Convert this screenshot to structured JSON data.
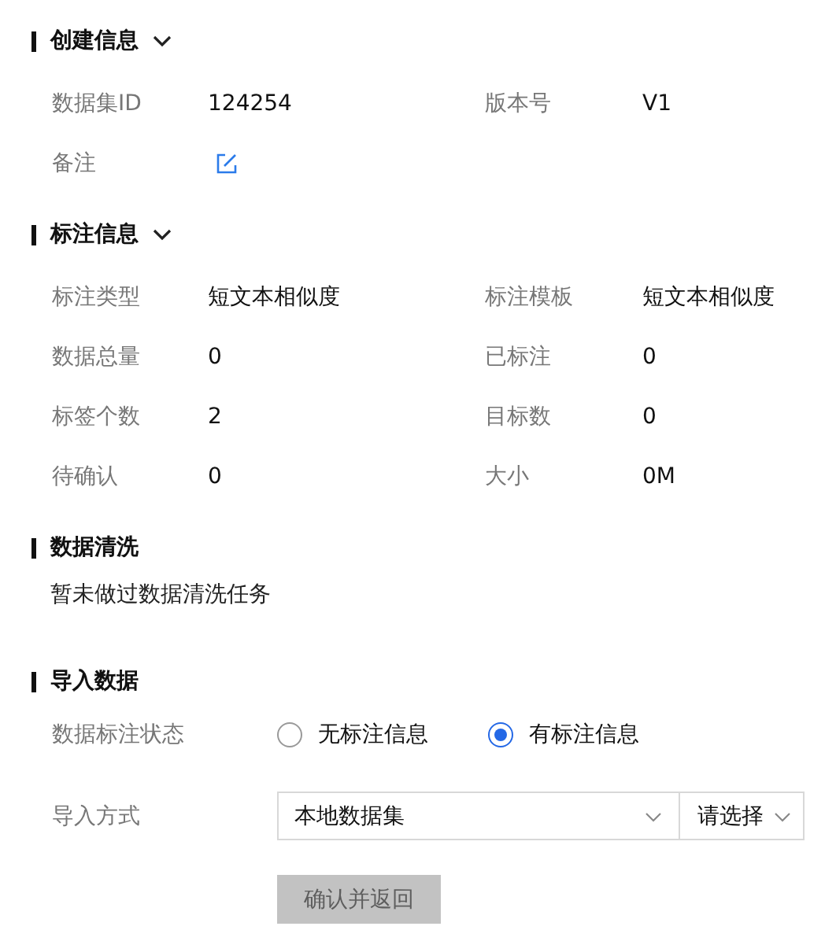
{
  "sections": [
    {
      "kind": "fields",
      "title": "创建信息",
      "expanded": true,
      "rows": [
        [
          {
            "label": "数据集ID",
            "value": "124254"
          },
          {
            "label": "版本号",
            "value": "V1"
          }
        ],
        [
          {
            "label": "备注",
            "kind": "edit"
          }
        ]
      ]
    },
    {
      "kind": "fields",
      "title": "标注信息",
      "expanded": true,
      "rows": [
        [
          {
            "label": "标注类型",
            "value": "短文本相似度"
          },
          {
            "label": "标注模板",
            "value": "短文本相似度"
          }
        ],
        [
          {
            "label": "数据总量",
            "value": "0"
          },
          {
            "label": "已标注",
            "value": "0"
          }
        ],
        [
          {
            "label": "标签个数",
            "value": "2"
          },
          {
            "label": "目标数",
            "value": "0"
          }
        ],
        [
          {
            "label": "待确认",
            "value": "0"
          },
          {
            "label": "大小",
            "value": "0M"
          }
        ]
      ]
    },
    {
      "kind": "text",
      "title": "数据清洗",
      "text": "暂未做过数据清洗任务"
    },
    {
      "kind": "form",
      "title": "导入数据",
      "radio": {
        "label": "数据标注状态",
        "options": [
          {
            "label": "无标注信息",
            "selected": false
          },
          {
            "label": "有标注信息",
            "selected": true
          }
        ]
      },
      "import": {
        "label": "导入方式",
        "selects": [
          {
            "value": "本地数据集"
          },
          {
            "value": "请选择"
          }
        ]
      },
      "button": {
        "label": "确认并返回",
        "disabled": true
      }
    }
  ]
}
